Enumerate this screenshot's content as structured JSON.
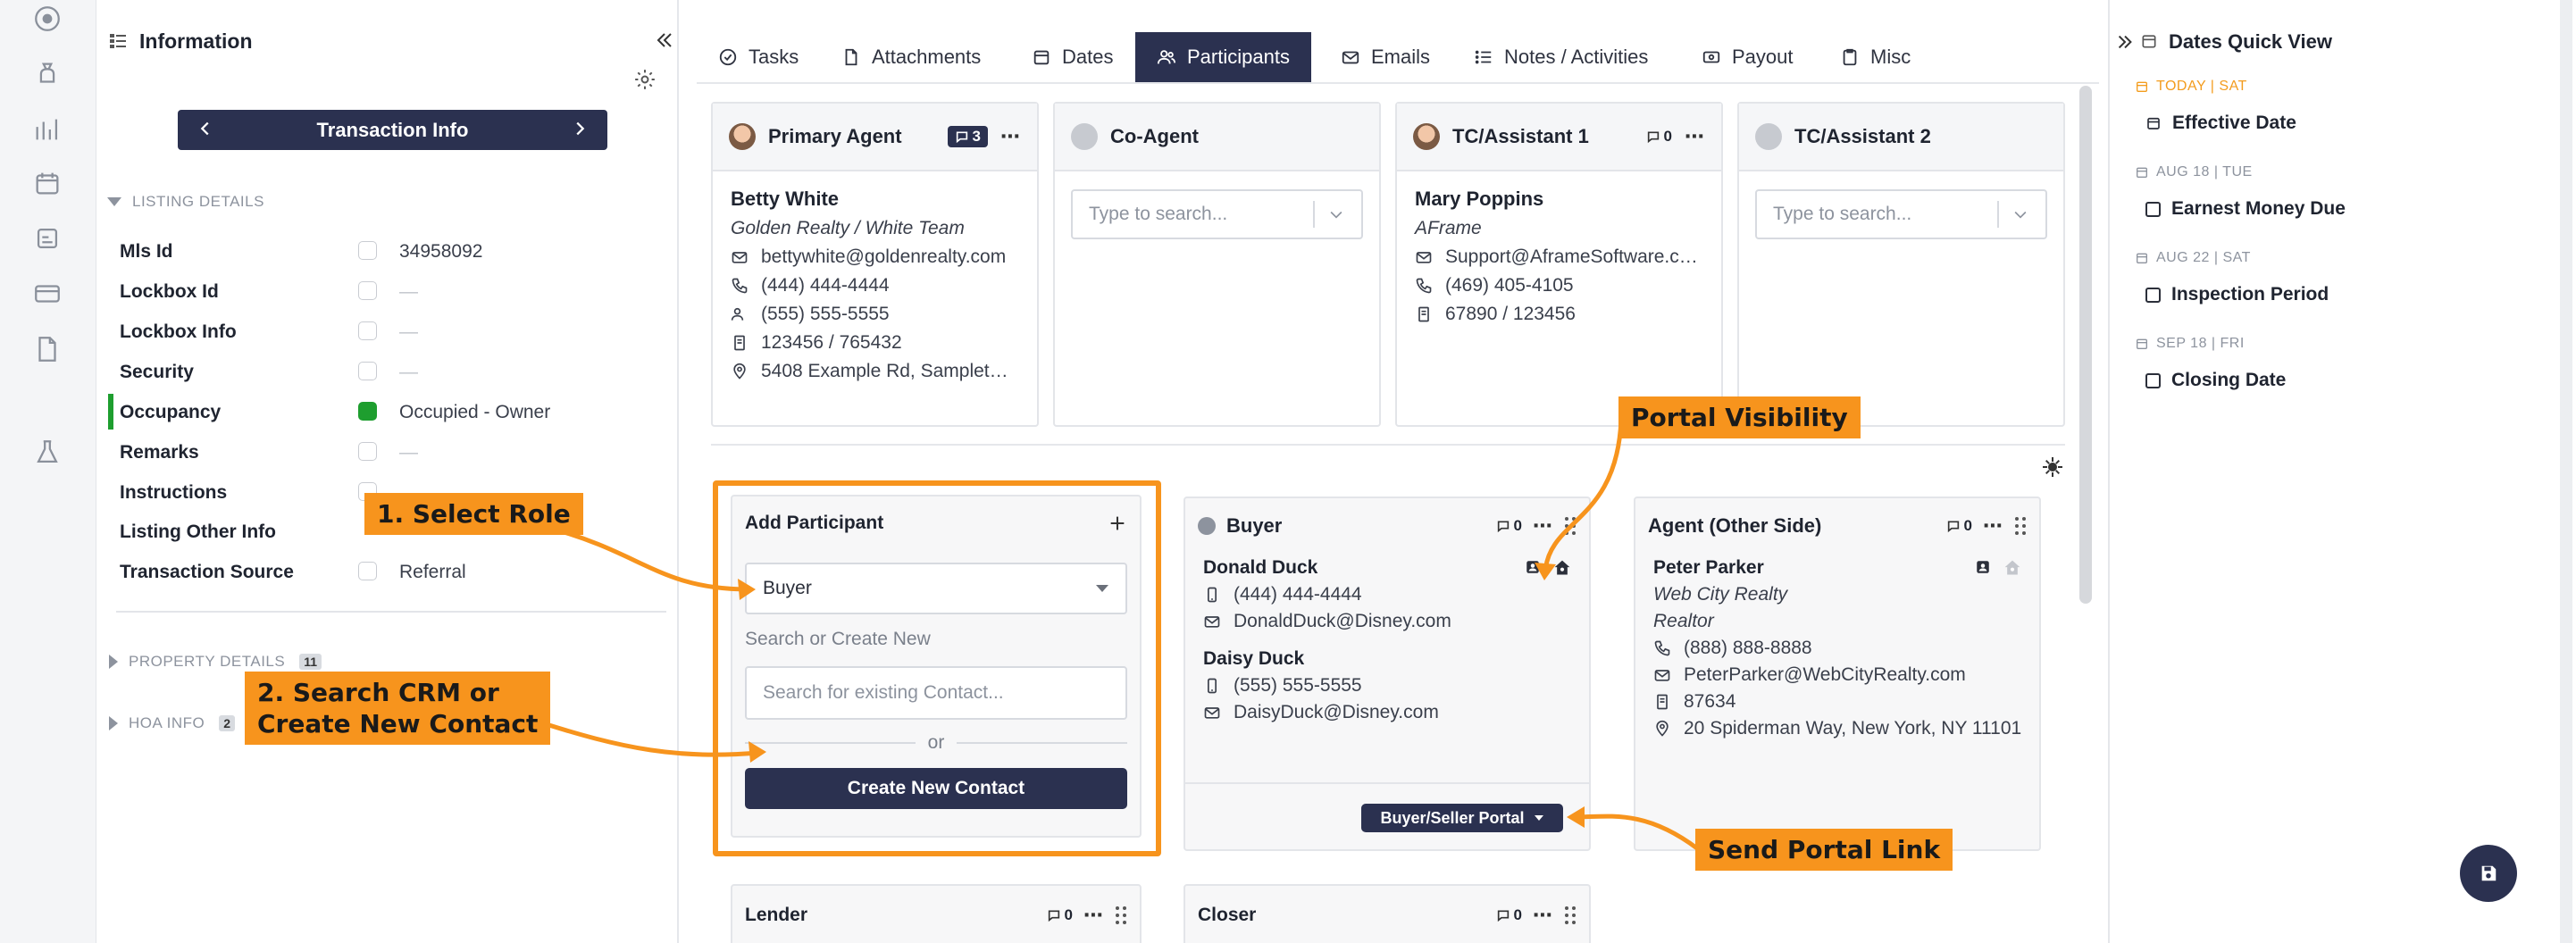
{
  "info_panel": {
    "title": "Information",
    "nav_title": "Transaction Info",
    "listing_details_header": "LISTING DETAILS",
    "fields": [
      {
        "label": "Mls Id",
        "value": "34958092"
      },
      {
        "label": "Lockbox Id",
        "value": "—"
      },
      {
        "label": "Lockbox Info",
        "value": "—"
      },
      {
        "label": "Security",
        "value": "—"
      },
      {
        "label": "Occupancy",
        "value": "Occupied - Owner"
      },
      {
        "label": "Remarks",
        "value": "—"
      },
      {
        "label": "Instructions",
        "value": "—"
      },
      {
        "label": "Listing Other Info",
        "value": ""
      },
      {
        "label": "Transaction Source",
        "value": "Referral"
      }
    ],
    "property_details": "PROPERTY DETAILS",
    "property_details_count": "11",
    "hoa_info": "HOA INFO",
    "hoa_info_count": "2"
  },
  "tabs": [
    {
      "label": "Tasks"
    },
    {
      "label": "Attachments"
    },
    {
      "label": "Dates"
    },
    {
      "label": "Participants"
    },
    {
      "label": "Emails"
    },
    {
      "label": "Notes / Activities"
    },
    {
      "label": "Payout"
    },
    {
      "label": "Misc"
    }
  ],
  "active_tab": "Participants",
  "top_cards": {
    "primary_agent": {
      "title": "Primary Agent",
      "msg_count": "3",
      "name": "Betty White",
      "company": "Golden Realty / White Team",
      "email": "bettywhite@goldenrealty.com",
      "phone1": "(444) 444-4444",
      "phone2": "(555) 555-5555",
      "license": "123456 / 765432",
      "address": "5408 Example Rd, Samplet…"
    },
    "co_agent": {
      "title": "Co-Agent",
      "placeholder": "Type to search..."
    },
    "tc_assistant_1": {
      "title": "TC/Assistant 1",
      "msg_count": "0",
      "name": "Mary Poppins",
      "company": "AFrame",
      "email": "Support@AframeSoftware.c…",
      "phone": "(469) 405-4105",
      "license": "67890 / 123456"
    },
    "tc_assistant_2": {
      "title": "TC/Assistant 2",
      "placeholder": "Type to search..."
    }
  },
  "add_participant": {
    "title": "Add Participant",
    "role_value": "Buyer",
    "search_label": "Search or Create New",
    "search_placeholder": "Search for existing Contact...",
    "or_text": "or",
    "create_button": "Create New Contact"
  },
  "buyer_card": {
    "title": "Buyer",
    "msg_count": "0",
    "contact1_name": "Donald Duck",
    "contact1_phone": "(444) 444-4444",
    "contact1_email": "DonaldDuck@Disney.com",
    "contact2_name": "Daisy Duck",
    "contact2_phone": "(555) 555-5555",
    "contact2_email": "DaisyDuck@Disney.com",
    "portal_button": "Buyer/Seller Portal"
  },
  "agent_other_side": {
    "title": "Agent (Other Side)",
    "msg_count": "0",
    "name": "Peter Parker",
    "company": "Web City Realty",
    "role": "Realtor",
    "phone": "(888) 888-8888",
    "email": "PeterParker@WebCityRealty.com",
    "license": "87634",
    "address": "20 Spiderman Way, New York, NY 11101"
  },
  "bottom_cards": {
    "lender": {
      "title": "Lender",
      "msg_count": "0"
    },
    "closer": {
      "title": "Closer",
      "msg_count": "0"
    }
  },
  "dates_panel": {
    "title": "Dates Quick View",
    "items": [
      {
        "date": "TODAY | SAT",
        "label": "Effective Date"
      },
      {
        "date": "AUG 18 | TUE",
        "label": "Earnest Money Due"
      },
      {
        "date": "AUG 22 | SAT",
        "label": "Inspection Period"
      },
      {
        "date": "SEP 18 | FRI",
        "label": "Closing Date"
      }
    ]
  },
  "annotations": {
    "select_role": "1. Select Role",
    "search_crm_line1": "2. Search CRM or",
    "search_crm_line2": "Create New Contact",
    "portal_visibility": "Portal Visibility",
    "send_portal_link": "Send Portal Link"
  },
  "colors": {
    "navy": "#2b3150",
    "annotation_orange": "#f7941d",
    "today_orange": "#f39c1e",
    "occupancy_green": "#1e9e2f"
  }
}
